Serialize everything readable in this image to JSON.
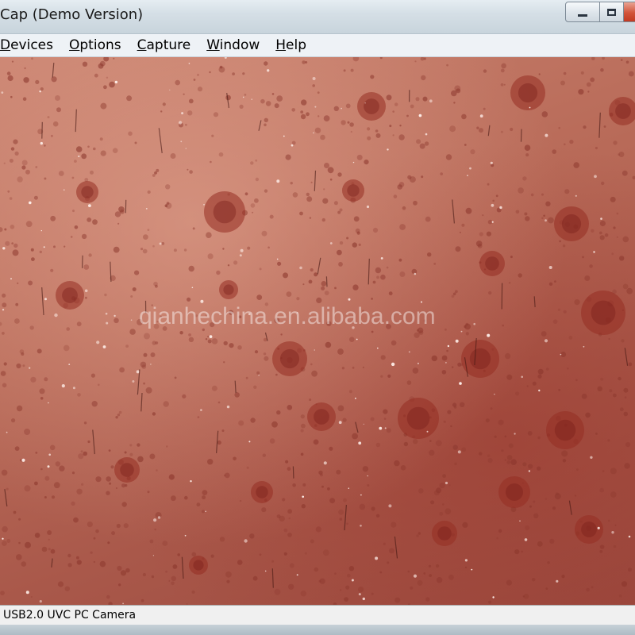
{
  "window": {
    "title": "Cap (Demo Version)"
  },
  "menu": {
    "items": [
      {
        "label_acc": "D",
        "label_rest": "evices"
      },
      {
        "label_acc": "O",
        "label_rest": "ptions"
      },
      {
        "label_acc": "C",
        "label_rest": "apture"
      },
      {
        "label_acc": "W",
        "label_rest": "indow"
      },
      {
        "label_acc": "H",
        "label_rest": "elp"
      }
    ]
  },
  "camera": {
    "watermark": "qianhechina.en.alibaba.com"
  },
  "status": {
    "text": "USB2.0 UVC PC Camera"
  },
  "icons": {
    "minimize": "minimize-icon",
    "maximize": "maximize-icon",
    "close": "close-icon"
  },
  "colors": {
    "skin_base": "#b86a58",
    "titlebar": "#d5dfe6",
    "close_button": "#d2543a"
  }
}
